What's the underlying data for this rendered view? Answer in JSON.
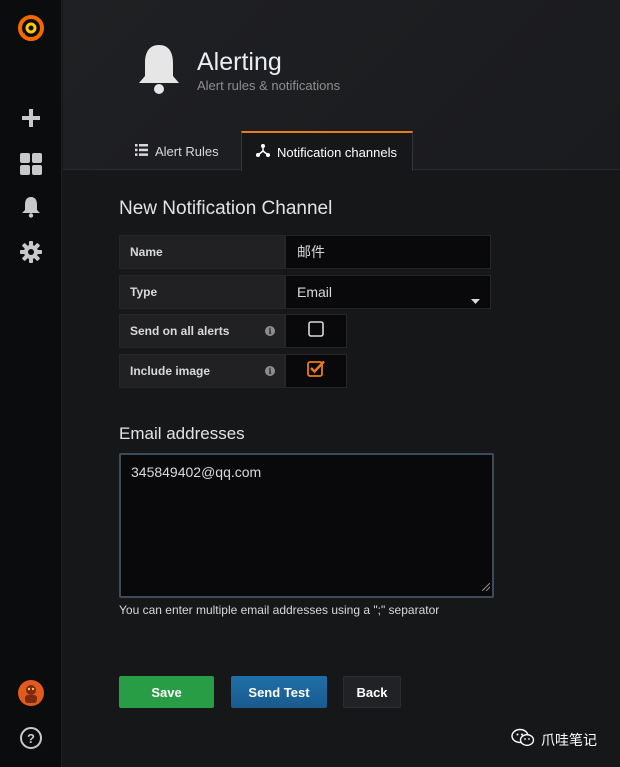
{
  "header": {
    "title": "Alerting",
    "subtitle": "Alert rules & notifications"
  },
  "tabs": [
    {
      "label": "Alert Rules",
      "icon": "list-icon",
      "active": false
    },
    {
      "label": "Notification channels",
      "icon": "sitemap-icon",
      "active": true
    }
  ],
  "form": {
    "title": "New Notification Channel",
    "name_label": "Name",
    "name_value": "邮件",
    "type_label": "Type",
    "type_value": "Email",
    "send_all_label": "Send on all alerts",
    "send_all_checked": false,
    "include_image_label": "Include image",
    "include_image_checked": true,
    "info_glyph": "i"
  },
  "email": {
    "title": "Email addresses",
    "value": "345849402@qq.com",
    "help": "You can enter multiple email addresses using a \";\" separator"
  },
  "buttons": {
    "save": "Save",
    "send_test": "Send Test",
    "back": "Back"
  },
  "sidebar": {
    "help_glyph": "?"
  },
  "watermark": {
    "text": "爪哇笔记"
  },
  "colors": {
    "accent": "#eb7b18",
    "save": "#299c46",
    "send_test": "#1f60a8",
    "back": "#202226"
  }
}
